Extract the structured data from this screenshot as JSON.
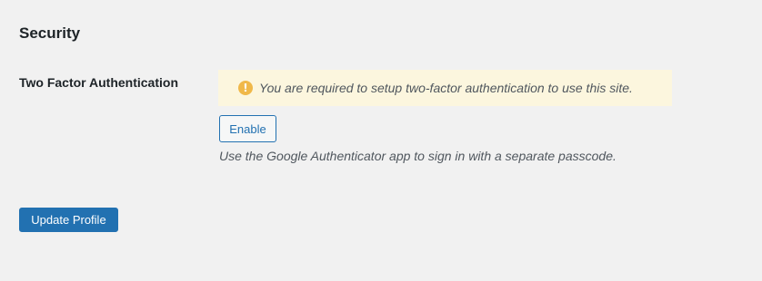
{
  "security": {
    "title": "Security",
    "two_factor": {
      "label": "Two Factor Authentication",
      "notice": {
        "icon": "warning-icon",
        "icon_glyph": "!",
        "icon_color": "#f0b849",
        "background": "#fcf6de",
        "text": "You are required to setup two-factor authentication to use this site."
      },
      "enable_label": "Enable",
      "description": "Use the Google Authenticator app to sign in with a separate passcode."
    }
  },
  "actions": {
    "update_profile_label": "Update Profile",
    "accent_color": "#2271b1"
  }
}
